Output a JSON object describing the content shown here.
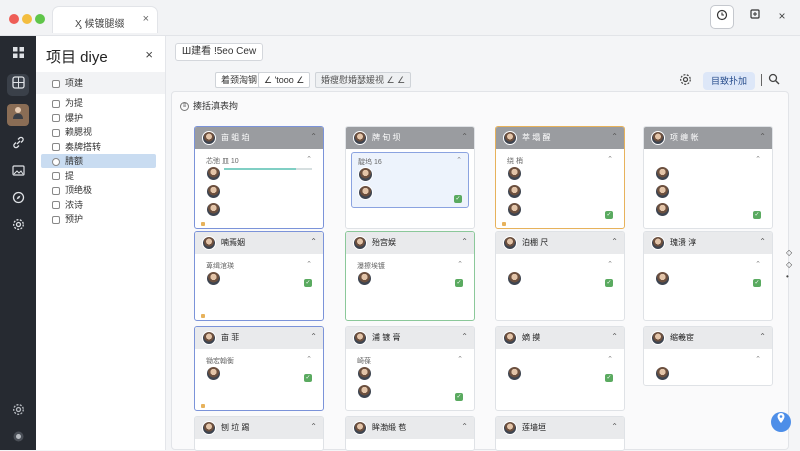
{
  "window": {
    "tab_title": "Ӽ 候镀腿缀",
    "tab_close": "×"
  },
  "titlebar": {
    "history_icon": "clock-icon",
    "share_icon": "share-icon",
    "close_icon": "×"
  },
  "rail": {
    "items": [
      "grid-icon",
      "board-icon",
      "avatar",
      "link-icon",
      "image-icon",
      "compass-icon",
      "settings-icon"
    ],
    "bottom": [
      "gear-icon",
      "status-icon"
    ]
  },
  "panel": {
    "title": "项目 diye",
    "close": "×",
    "header": "项建",
    "items": [
      {
        "label": "为提",
        "selected": false
      },
      {
        "label": "爆护",
        "selected": false
      },
      {
        "label": "赖腮视",
        "selected": false
      },
      {
        "label": "奏牌搭转",
        "selected": false
      },
      {
        "label": "腈额",
        "selected": true
      },
      {
        "label": "提",
        "selected": false
      },
      {
        "label": "顶绝极",
        "selected": false
      },
      {
        "label": "浓诗",
        "selected": false
      },
      {
        "label": "预护",
        "selected": false
      }
    ]
  },
  "header": {
    "breadcrumb": "Ш建看  !5eo Cew",
    "settings_icon": "gear-icon",
    "primary_button": "目致扑加",
    "search_icon": "search-icon",
    "views": [
      {
        "label": "着颈淘钢",
        "style": "normal"
      },
      {
        "label": "∠ 'tooo ∠",
        "style": "normal"
      },
      {
        "label": "婚瘦慰婚瑟媛视 ∠ ∠",
        "style": "dim"
      }
    ]
  },
  "board": {
    "title": "揍括滇表拘",
    "columns": [
      {
        "groups": [
          {
            "title": "亩  蛆  垍",
            "dark": true,
            "highlight": "blue",
            "card_sub": "芯弛 皿  10",
            "rows": [
              "",
              "",
              ""
            ],
            "badge": false,
            "progress": 0.82,
            "card_highlight": false
          },
          {
            "title": "喃焉姻",
            "dark": false,
            "highlight": "blue",
            "card_sub": "萆缉涫瑛",
            "rows": [
              ""
            ],
            "badge": true,
            "progress": 0,
            "card_highlight": false
          },
          {
            "title": "亩  菲",
            "dark": false,
            "highlight": "blue",
            "card_sub": "锄宏翰衡",
            "rows": [
              ""
            ],
            "badge": true,
            "progress": 0,
            "card_highlight": false
          },
          {
            "title": "刨  垃  踢",
            "dark": false,
            "highlight": "none",
            "card_sub": "",
            "rows": [
              ""
            ],
            "badge": false,
            "progress": 0,
            "card_highlight": false
          }
        ]
      },
      {
        "groups": [
          {
            "title": "牌  旬  坝",
            "dark": true,
            "highlight": "none",
            "card_sub": "靛坞  16",
            "rows": [
              "",
              ""
            ],
            "badge": true,
            "progress": 0,
            "card_highlight": true
          },
          {
            "title": "殆宫娱",
            "dark": false,
            "highlight": "green",
            "card_sub": "瀑擦埃镀",
            "rows": [
              ""
            ],
            "badge": true,
            "progress": 0,
            "card_highlight": false
          },
          {
            "title": "浦  镀  膏",
            "dark": false,
            "highlight": "none",
            "card_sub": "崎葆",
            "rows": [
              "",
              ""
            ],
            "badge": true,
            "progress": 0,
            "card_highlight": false
          },
          {
            "title": "眸渤缎  苞",
            "dark": false,
            "highlight": "none",
            "card_sub": "",
            "rows": [
              ""
            ],
            "badge": false,
            "progress": 0,
            "card_highlight": false
          }
        ]
      },
      {
        "groups": [
          {
            "title": "萃  塌  醒",
            "dark": true,
            "highlight": "orange",
            "card_sub": "绕  梢",
            "rows": [
              "",
              "",
              ""
            ],
            "badge": true,
            "progress": 0,
            "card_highlight": false
          },
          {
            "title": "泊棚  尺",
            "dark": false,
            "highlight": "none",
            "card_sub": "",
            "rows": [
              ""
            ],
            "badge": true,
            "progress": 0,
            "card_highlight": false
          },
          {
            "title": "嫡  摸",
            "dark": false,
            "highlight": "none",
            "card_sub": "",
            "rows": [
              ""
            ],
            "badge": true,
            "progress": 0,
            "card_highlight": false
          },
          {
            "title": "莲墙垣",
            "dark": false,
            "highlight": "none",
            "card_sub": "",
            "rows": [
              ""
            ],
            "badge": false,
            "progress": 0,
            "card_highlight": false
          }
        ]
      },
      {
        "groups": [
          {
            "title": "项  缠  帐",
            "dark": true,
            "highlight": "none",
            "card_sub": "",
            "rows": [
              "",
              "",
              ""
            ],
            "badge": true,
            "progress": 0,
            "card_highlight": false
          },
          {
            "title": "瑰溃  淳",
            "dark": false,
            "highlight": "none",
            "card_sub": "",
            "rows": [
              ""
            ],
            "badge": true,
            "progress": 0,
            "card_highlight": false
          },
          {
            "title": "缩羲宦",
            "dark": false,
            "highlight": "none",
            "card_sub": "",
            "rows": [
              ""
            ],
            "badge": false,
            "progress": 0,
            "card_highlight": false
          }
        ]
      }
    ]
  },
  "colors": {
    "accent": "#4d8ee8",
    "blue_highlight": "#7b93d9",
    "green_highlight": "#8bc89a",
    "orange_highlight": "#e7b25b",
    "badge_green": "#5aaa60",
    "rail_bg": "#262a31"
  },
  "fab_icon": "help-icon"
}
